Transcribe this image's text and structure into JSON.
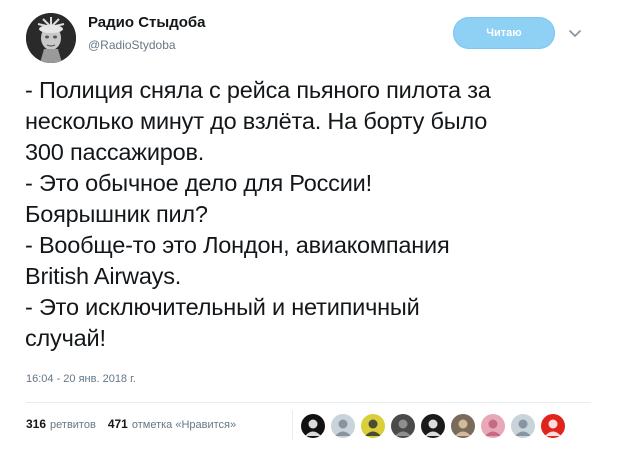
{
  "user": {
    "display_name": "Радио Стыдоба",
    "handle": "@RadioStydoba",
    "avatar_icon": "statue-of-liberty-avatar-icon"
  },
  "follow_button": {
    "label": "Читаю",
    "color": "#8fd0f5"
  },
  "menu_icon": "chevron-down-icon",
  "tweet": {
    "lines": [
      "- Полиция сняла с рейса пьяного пилота за",
      "несколько минут до взлёта. На борту было",
      "300 пассажиров.",
      "- Это обычное дело для России!",
      "Боярышник пил?",
      "- Вообще-то это Лондон, авиакомпания",
      "British Airways.",
      "- Это исключительный и нетипичный",
      "случай!"
    ],
    "timestamp": "16:04 - 20 янв. 2018 г."
  },
  "stats": {
    "retweets_count": "316",
    "retweets_label": "ретвитов",
    "likes_count": "471",
    "likes_label": "отметка «Нравится»"
  },
  "likers": [
    {
      "name": "liker-avatar-1",
      "color": "#111111",
      "accent": "#ffffff"
    },
    {
      "name": "liker-avatar-2",
      "color": "#c9d3da",
      "accent": "#7b8a96"
    },
    {
      "name": "liker-avatar-3",
      "color": "#d8cf3a",
      "accent": "#333333"
    },
    {
      "name": "liker-avatar-4",
      "color": "#4a4a4a",
      "accent": "#9a9a9a"
    },
    {
      "name": "liker-avatar-5",
      "color": "#1a1a1a",
      "accent": "#ffffff"
    },
    {
      "name": "liker-avatar-6",
      "color": "#7a6a5a",
      "accent": "#e0c9a6"
    },
    {
      "name": "liker-avatar-7",
      "color": "#e8a8b8",
      "accent": "#c0607a"
    },
    {
      "name": "liker-avatar-8",
      "color": "#c9d3da",
      "accent": "#7b8a96"
    },
    {
      "name": "liker-avatar-9",
      "color": "#e0241b",
      "accent": "#ffffff"
    }
  ]
}
